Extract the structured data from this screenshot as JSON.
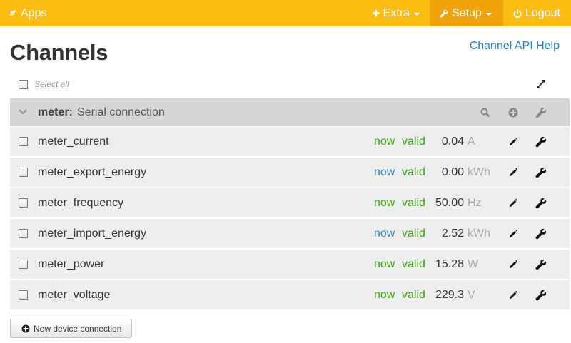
{
  "navbar": {
    "brand": "Apps",
    "extra_label": "Extra",
    "setup_label": "Setup",
    "logout_label": "Logout",
    "colors": {
      "bar": "#fbbd12",
      "active": "#f0a30a"
    }
  },
  "page": {
    "title": "Channels",
    "api_help_link": "Channel API Help",
    "select_all_label": "Select all"
  },
  "group": {
    "name": "meter:",
    "description": "Serial connection"
  },
  "channels": [
    {
      "name": "meter_current",
      "time": "now",
      "time_color": "green",
      "status": "valid",
      "value": "0.04",
      "unit": "A"
    },
    {
      "name": "meter_export_energy",
      "time": "now",
      "time_color": "blue",
      "status": "valid",
      "value": "0.00",
      "unit": "kWh"
    },
    {
      "name": "meter_frequency",
      "time": "now",
      "time_color": "green",
      "status": "valid",
      "value": "50.00",
      "unit": "Hz"
    },
    {
      "name": "meter_import_energy",
      "time": "now",
      "time_color": "blue",
      "status": "valid",
      "value": "2.52",
      "unit": "kWh"
    },
    {
      "name": "meter_power",
      "time": "now",
      "time_color": "green",
      "status": "valid",
      "value": "15.28",
      "unit": "W"
    },
    {
      "name": "meter_voltage",
      "time": "now",
      "time_color": "green",
      "status": "valid",
      "value": "229.3",
      "unit": "V"
    }
  ],
  "footer": {
    "new_device_button": "New device connection"
  }
}
